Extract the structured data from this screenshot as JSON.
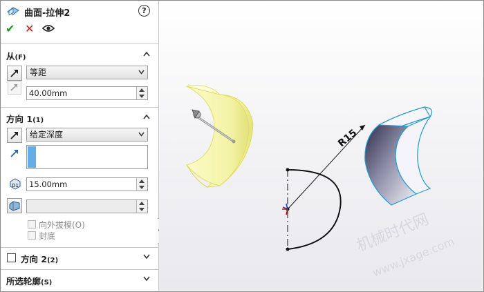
{
  "feature": {
    "title": "曲面-拉伸2",
    "help_label": "?"
  },
  "actions": {
    "ok": "✔",
    "cancel": "✕"
  },
  "from": {
    "title": "从",
    "key": "(F)",
    "condition": "等距",
    "offset": "40.00mm"
  },
  "direction1": {
    "title": "方向 1",
    "key": "(1)",
    "end_condition": "给定深度",
    "depth": "15.00mm",
    "draft": "",
    "draft_outward": "向外拔模(O)",
    "cap_end": "封底"
  },
  "direction2": {
    "title": "方向 2",
    "key": "(2)"
  },
  "contours": {
    "title": "所选轮廓",
    "key": "(S)"
  },
  "viewport": {
    "dimension": "R15",
    "watermark_cn": "机械时代网",
    "watermark_url": "www.jxage.com"
  },
  "colors": {
    "accent": "#63aee8",
    "ok": "#1b9a1b",
    "cancel": "#dd1111",
    "surface_edge": "#1e9bd7",
    "preview_yellow": "#f5f590"
  }
}
